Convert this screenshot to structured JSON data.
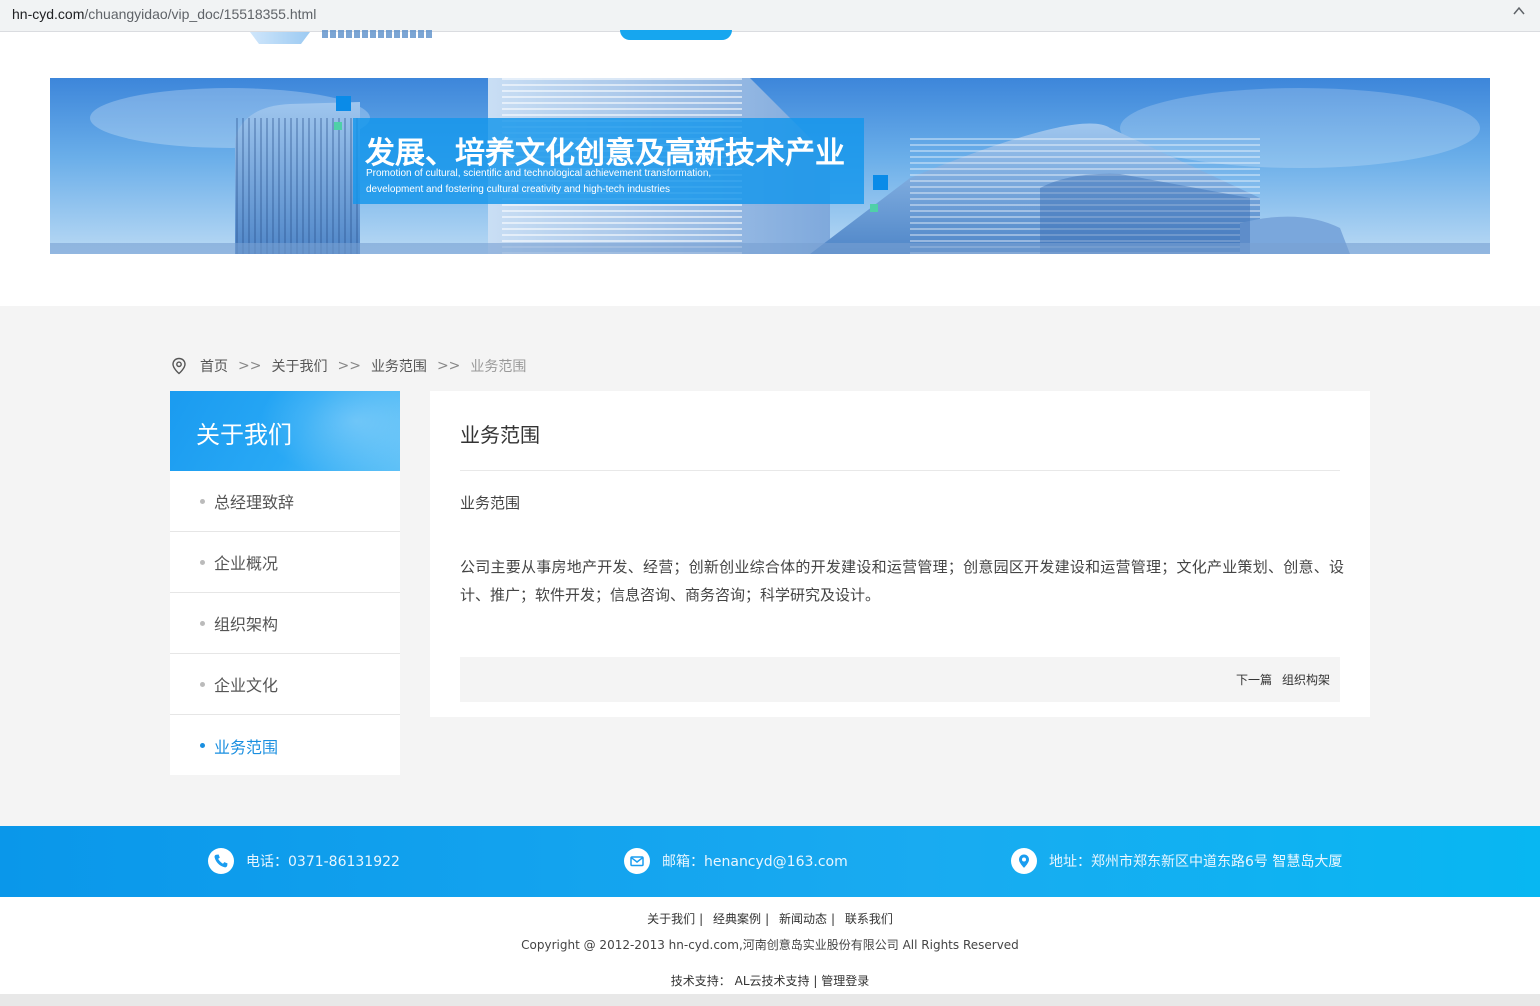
{
  "browser": {
    "url_host": "hn-cyd.com",
    "url_path": "/chuangyidao/vip_doc/15518355.html"
  },
  "banner": {
    "title": "发展、培养文化创意及高新技术产业",
    "subtitle_line1": "Promotion of cultural, scientific and technological achievement transformation,",
    "subtitle_line2": "development and fostering cultural creativity and high-tech industries"
  },
  "breadcrumb": {
    "items": [
      "首页",
      "关于我们",
      "业务范围"
    ],
    "separator": ">>",
    "current": "业务范围"
  },
  "sidebar": {
    "title": "关于我们",
    "items": [
      {
        "label": "总经理致辞",
        "active": false
      },
      {
        "label": "企业概况",
        "active": false
      },
      {
        "label": "组织架构",
        "active": false
      },
      {
        "label": "企业文化",
        "active": false
      },
      {
        "label": "业务范围",
        "active": true
      }
    ],
    "accent_color": "#1a8fe0"
  },
  "article": {
    "heading": "业务范围",
    "subheading": "业务范围",
    "body": "公司主要从事房地产开发、经营；创新创业综合体的开发建设和运营管理；创意园区开发建设和运营管理；文化产业策划、创意、设计、推广；软件开发；信息咨询、商务咨询；科学研究及设计。",
    "next_label": "下一篇",
    "next_title": "组织构架"
  },
  "contact": {
    "phone": "电话：0371-86131922",
    "email": "邮箱：henancyd@163.com",
    "address": "地址：郑州市郑东新区中道东路6号 智慧岛大厦",
    "icons": [
      "phone-icon",
      "mail-icon",
      "location-icon"
    ]
  },
  "footer": {
    "links": [
      "关于我们",
      "经典案例",
      "新闻动态",
      "联系我们"
    ],
    "copyright": "Copyright @ 2012-2013 hn-cyd.com,河南创意岛实业股份有限公司 All Rights Reserved",
    "support_label": "技术支持：",
    "support_link": "AL云技术支持",
    "admin_link": "管理登录"
  }
}
